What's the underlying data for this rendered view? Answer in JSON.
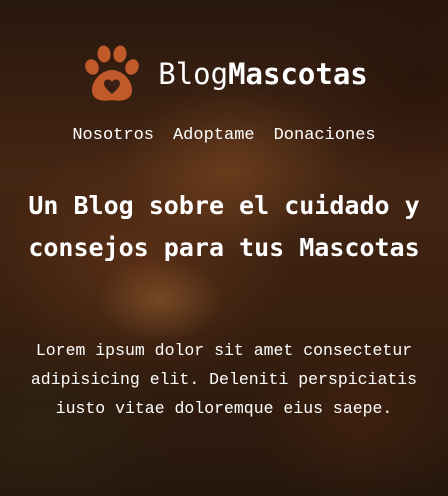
{
  "brand": {
    "light": "Blog",
    "bold": "Mascotas",
    "icon": "paw-heart-icon",
    "icon_color": "#c05a2b"
  },
  "nav": {
    "items": [
      {
        "label": "Nosotros"
      },
      {
        "label": "Adoptame"
      },
      {
        "label": "Donaciones"
      }
    ]
  },
  "hero": {
    "title": "Un Blog sobre el cuidado y consejos para tus Mascotas",
    "text": "Lorem ipsum dolor sit amet consectetur adipisicing elit. Deleniti perspiciatis iusto vitae doloremque eius saepe."
  }
}
